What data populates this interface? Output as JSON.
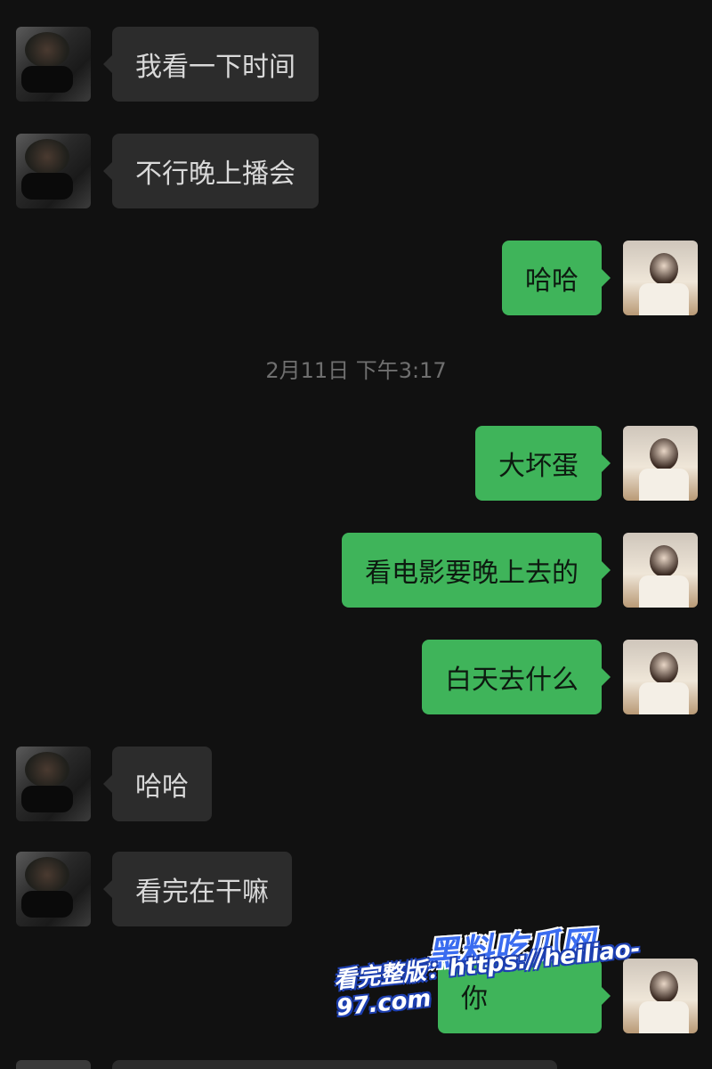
{
  "messages": [
    {
      "side": "left",
      "text": "我看一下时间"
    },
    {
      "side": "left",
      "text": "不行晚上播会"
    },
    {
      "side": "right",
      "text": "哈哈"
    },
    {
      "side": "right",
      "text": "大坏蛋"
    },
    {
      "side": "right",
      "text": "看电影要晚上去的"
    },
    {
      "side": "right",
      "text": "白天去什么"
    },
    {
      "side": "left",
      "text": "哈哈"
    },
    {
      "side": "left",
      "text": "看完在干嘛"
    },
    {
      "side": "right",
      "text": "你"
    }
  ],
  "timestamp": "2月11日 下午3:17",
  "watermark": {
    "title": "黑料吃瓜网",
    "url": "看完整版：https://heiliao-97.com"
  },
  "colors": {
    "background": "#111111",
    "incoming_bubble": "#2c2c2c",
    "outgoing_bubble": "#3fb45a"
  }
}
